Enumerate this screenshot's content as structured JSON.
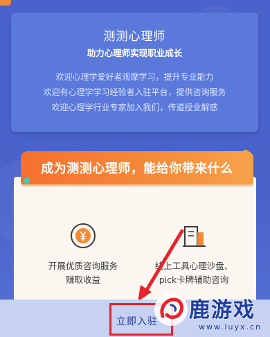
{
  "intro": {
    "title": "测测心理师",
    "subtitle": "助力心理师实现职业成长",
    "lines": [
      "欢迎心理学爱好者观摩学习，提升专业能力",
      "欢迎有心理学学习经验者入驻平台，提供咨询服务",
      "欢迎心理学行业专家加入我们，传道授业解惑"
    ]
  },
  "benefits": {
    "banner": "成为测测心理师，能给你带来什么",
    "items": [
      {
        "icon": "yen-coin-icon",
        "line1": "开展优质咨询服务",
        "line2": "赚取收益"
      },
      {
        "icon": "tools-building-icon",
        "line1": "线上工具心理沙盘、",
        "line2": "pick卡牌辅助咨询"
      }
    ]
  },
  "footer": {
    "join_label": "立即入驻"
  },
  "watermark": {
    "title": "鹿游戏",
    "url": "www.luyx.cn"
  },
  "colors": {
    "bg": "#4a63cc",
    "banner": "#f6702e",
    "highlight": "#e8232b"
  }
}
